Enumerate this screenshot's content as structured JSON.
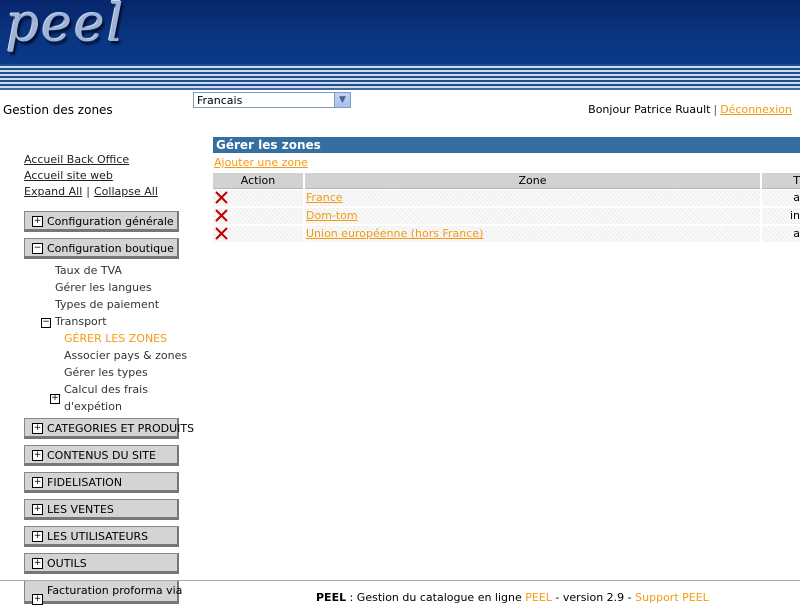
{
  "header": {
    "logo_text": "peel"
  },
  "topbar": {
    "page_title": "Gestion des zones",
    "language": "Francais",
    "greeting": "Bonjour Patrice Ruault",
    "separator": "|",
    "logout": "Déconnexion"
  },
  "sidebar": {
    "links": {
      "home_bo": "Accueil Back Office",
      "home_site": "Accueil site web",
      "expand": "Expand All",
      "sep": "|",
      "collapse": "Collapse All"
    },
    "menus": [
      {
        "label": "Configuration générale",
        "state": "+"
      },
      {
        "label": "Configuration boutique",
        "state": "−"
      },
      {
        "label": "CATEGORIES ET PRODUITS",
        "state": "+"
      },
      {
        "label": "CONTENUS DU SITE",
        "state": "+"
      },
      {
        "label": "FIDELISATION",
        "state": "+"
      },
      {
        "label": "LES VENTES",
        "state": "+"
      },
      {
        "label": "LES UTILISATEURS",
        "state": "+"
      },
      {
        "label": "OUTILS",
        "state": "+"
      },
      {
        "label": "Facturation proforma via",
        "state": "+"
      }
    ],
    "submenu": {
      "tva": "Taux de TVA",
      "langues": "Gérer les langues",
      "paiement": "Types de paiement",
      "transport": "Transport",
      "transport_state": "−",
      "zones": "GÉRER LES ZONES",
      "associer": "Associer pays & zones",
      "types": "Gérer les types",
      "calcul_1": "Calcul des frais",
      "calcul_2": "d'expétion",
      "calcul_state": "+"
    }
  },
  "main": {
    "title": "Gérer les zones",
    "add_link": "Ajouter une zone",
    "columns": [
      "Action",
      "Zone",
      "T"
    ],
    "rows": [
      {
        "zone": "France",
        "extra": "a"
      },
      {
        "zone": "Dom-tom",
        "extra": "in"
      },
      {
        "zone": "Union européenne (hors France)",
        "extra": "a"
      }
    ]
  },
  "footer": {
    "brand": "PEEL",
    "text": " : Gestion du catalogue en ligne ",
    "peel_link": "PEEL",
    "version": " - version 2.9 - ",
    "support": "Support PEEL"
  },
  "colors": {
    "accent": "#f39a10",
    "header": "#0a3580",
    "panel_title": "#356fa1"
  }
}
